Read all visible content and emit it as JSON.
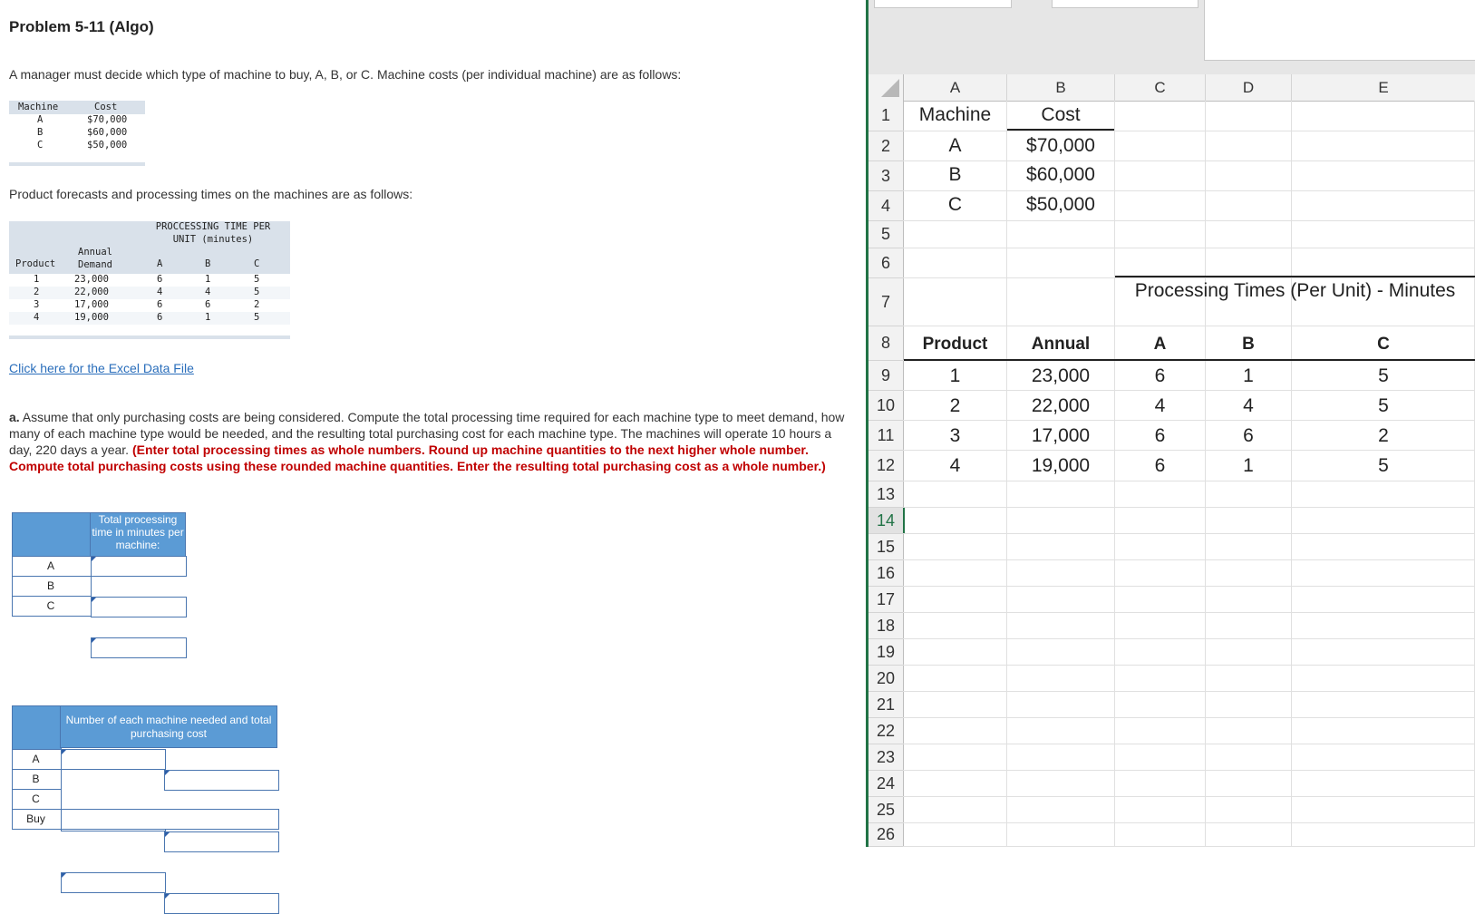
{
  "problem": {
    "title": "Problem 5-11 (Algo)",
    "intro": "A manager must decide which type of machine to buy, A, B, or C. Machine costs (per individual machine) are as follows:",
    "cost_table": {
      "headers": [
        "Machine",
        "Cost"
      ],
      "rows": [
        [
          "A",
          "$70,000"
        ],
        [
          "B",
          "$60,000"
        ],
        [
          "C",
          "$50,000"
        ]
      ]
    },
    "forecast_intro": "Product forecasts and processing times on the machines are as follows:",
    "forecast_table": {
      "group_header": "PROCCESSING TIME PER UNIT (minutes)",
      "headers": [
        "Product",
        "Annual Demand",
        "A",
        "B",
        "C"
      ],
      "rows": [
        [
          "1",
          "23,000",
          "6",
          "1",
          "5"
        ],
        [
          "2",
          "22,000",
          "4",
          "4",
          "5"
        ],
        [
          "3",
          "17,000",
          "6",
          "6",
          "2"
        ],
        [
          "4",
          "19,000",
          "6",
          "1",
          "5"
        ]
      ]
    },
    "link": "Click here for the Excel Data File",
    "question_lead": "a.",
    "question_text": " Assume that only purchasing costs are being considered. Compute the total processing time required for each machine type to meet demand, how many of each machine type would be needed, and the resulting total purchasing cost for each machine type. The machines will operate 10 hours a day, 220 days a year. ",
    "question_red": "(Enter total processing times as whole numbers. Round up machine quantities to the next higher whole number. Compute total purchasing costs using these rounded machine quantities. Enter the resulting total purchasing cost as a whole number.)",
    "answer1": {
      "header": "Total processing time in minutes per machine:",
      "rows": [
        "A",
        "B",
        "C"
      ]
    },
    "answer2": {
      "header": "Number of each machine needed and total purchasing cost",
      "rows": [
        "A",
        "B",
        "C",
        "Buy"
      ]
    }
  },
  "excel": {
    "columns": [
      "A",
      "B",
      "C",
      "D",
      "E"
    ],
    "rows": [
      "1",
      "2",
      "3",
      "4",
      "5",
      "6",
      "7",
      "8",
      "9",
      "10",
      "11",
      "12",
      "13",
      "14",
      "15",
      "16",
      "17",
      "18",
      "19",
      "20",
      "21",
      "22",
      "23",
      "24",
      "25",
      "26"
    ],
    "active_row": "14",
    "r1": [
      "Machine",
      "Cost"
    ],
    "r2": [
      "A",
      "$70,000"
    ],
    "r3": [
      "B",
      "$60,000"
    ],
    "r4": [
      "C",
      "$50,000"
    ],
    "r7": "Processing Times (Per Unit) - Minutes",
    "r8": [
      "Product",
      "Annual",
      "A",
      "B",
      "C"
    ],
    "r9": [
      "1",
      "23,000",
      "6",
      "1",
      "5"
    ],
    "r10": [
      "2",
      "22,000",
      "4",
      "4",
      "5"
    ],
    "r11": [
      "3",
      "17,000",
      "6",
      "6",
      "2"
    ],
    "r12": [
      "4",
      "19,000",
      "6",
      "1",
      "5"
    ]
  }
}
